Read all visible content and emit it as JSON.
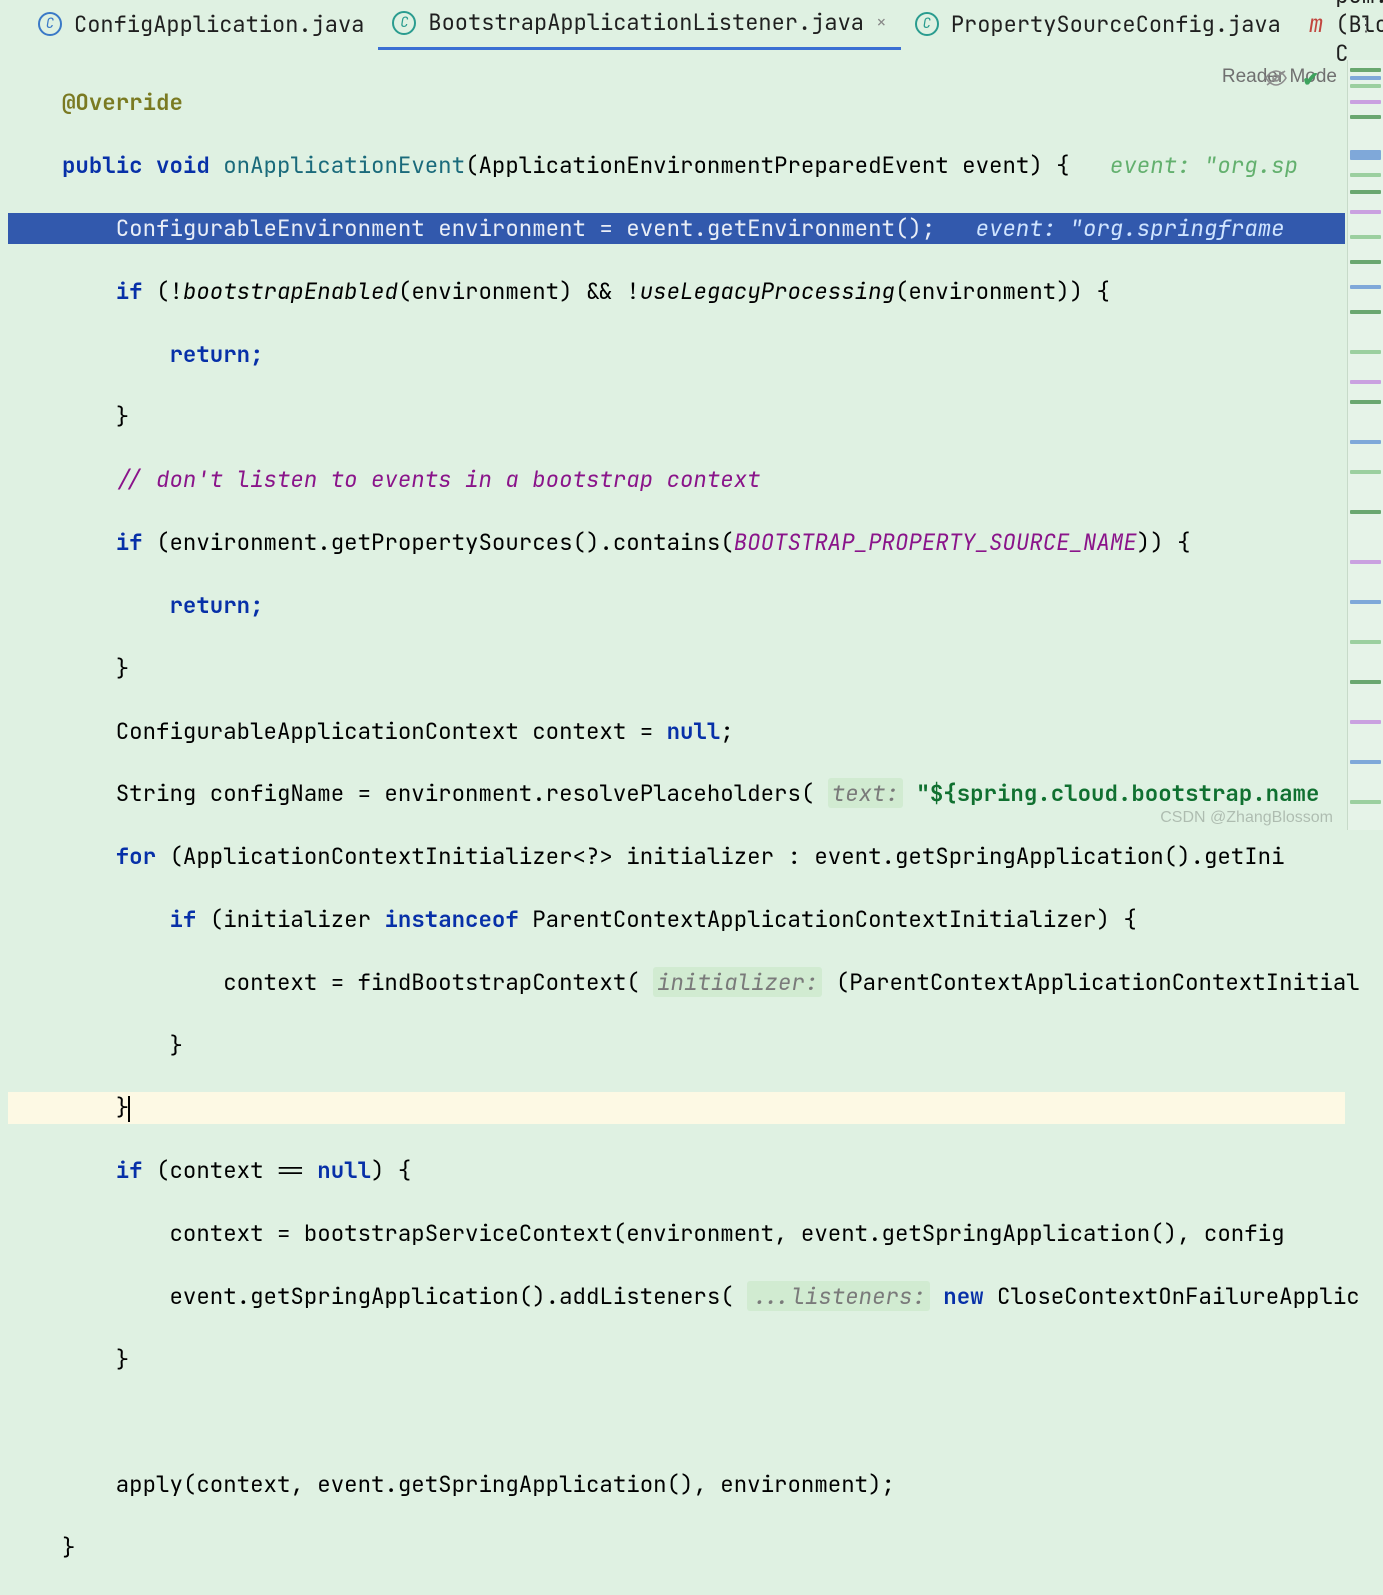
{
  "tabs": [
    {
      "icon": "C",
      "icon_style": "blue",
      "name": "ConfigApplication.java",
      "active": false,
      "closable": false
    },
    {
      "icon": "C",
      "icon_style": "teal",
      "name": "BootstrapApplicationListener.java",
      "active": true,
      "closable": true
    },
    {
      "icon": "C",
      "icon_style": "teal",
      "name": "PropertySourceConfig.java",
      "active": false,
      "closable": false
    },
    {
      "icon": "m",
      "icon_style": "m",
      "name": "pom.xml (BlossomConfig-C",
      "active": false,
      "closable": false,
      "dropdown": true
    }
  ],
  "right": {
    "reader": "Reader Mode",
    "eye": "👁",
    "check": "✓"
  },
  "indent": "      ",
  "code": {
    "ann": "@Override",
    "sig": {
      "kw_pub": "public",
      "kw_void": "void",
      "name": "onApplicationEvent",
      "paramType": "ApplicationEnvironmentPreparedEvent",
      "paramName": "event",
      "inlay_label": "event:",
      "inlay_val": "\"org.sp"
    },
    "sel": {
      "type": "ConfigurableEnvironment",
      "var": "environment",
      "assign": " = event.getEnvironment();",
      "inlay_label": "event:",
      "inlay_val": "\"org.springframe"
    },
    "if1": {
      "pre": "if (!",
      "m1": "bootstrapEnabled",
      "mid": "(environment) && !",
      "m2": "useLegacyProcessing",
      "post": "(environment)) {"
    },
    "ret": "return;",
    "cbrace": "}",
    "comment1": "// don't listen to events in a bootstrap context",
    "if2": {
      "pre": "if (environment.getPropertySources().contains(",
      "const": "BOOTSTRAP_PROPERTY_SOURCE_NAME",
      "post": ")) {"
    },
    "ctx_decl": {
      "pre": "ConfigurableApplicationContext context = ",
      "null": "null",
      "post": ";"
    },
    "cfgName": {
      "pre": "String configName = environment.resolvePlaceholders(",
      "hint": "text:",
      "str": "\"${spring.cloud.bootstrap.name"
    },
    "forln": {
      "kw": "for",
      "body": " (ApplicationContextInitializer<?> initializer : event.getSpringApplication().getIni"
    },
    "if3": {
      "pre": "if (initializer ",
      "kw": "instanceof",
      "post": " ParentContextApplicationContextInitializer) {"
    },
    "findBoot": {
      "pre": "context = findBootstrapContext(",
      "hint": "initializer:",
      "post": " (ParentContextApplicationContextInitial"
    },
    "cbrace_in": "}",
    "cursor_brace": "}",
    "if4": "if (context == ",
    "if4_null": "null",
    "if4_post": ") {",
    "boot": "context = bootstrapServiceContext(environment, event.getSpringApplication(), config",
    "addlis": {
      "pre": "event.getSpringApplication().addListeners(",
      "hint": "...listeners:",
      "kw": "new",
      "post": " CloseContextOnFailureApplic"
    },
    "apply": "apply(context, event.getSpringApplication(), environment);"
  },
  "watermark": "CSDN @ZhangBlossom"
}
